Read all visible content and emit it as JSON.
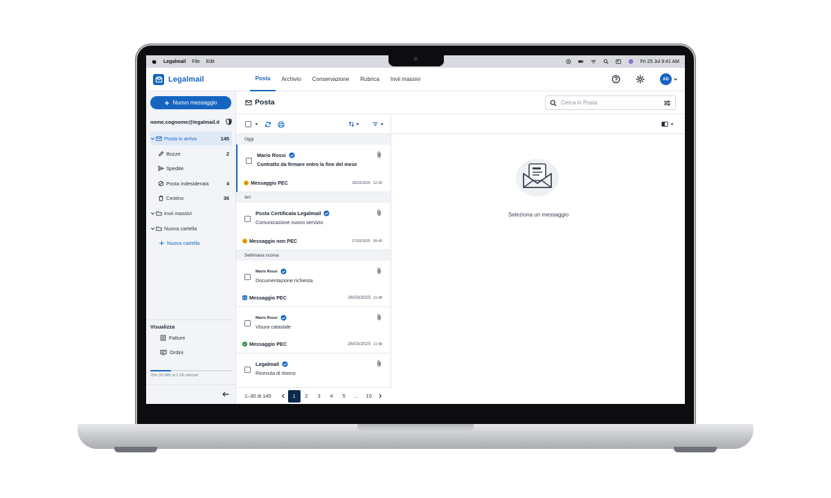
{
  "menubar": {
    "items": [
      "Legalmail",
      "File",
      "Edit"
    ],
    "datetime": "Fri 25 Jul  9:41 AM"
  },
  "brand": {
    "name": "Legalmail",
    "accent": "#1565c0"
  },
  "nav": {
    "tabs": [
      {
        "label": "Posta",
        "active": true
      },
      {
        "label": "Archivio"
      },
      {
        "label": "Conservazione"
      },
      {
        "label": "Rubrica"
      },
      {
        "label": "Invii massivi"
      }
    ],
    "avatar_initials": "AD"
  },
  "sidebar": {
    "new_message_label": "Nuovo messaggio",
    "account": "nome.cognome@legalmail.it",
    "folders": [
      {
        "label": "Posta in arrivo",
        "count": "145",
        "icon": "inbox-icon",
        "active": true
      },
      {
        "label": "Bozze",
        "count": "2",
        "icon": "pencil-icon"
      },
      {
        "label": "Spedite",
        "count": "",
        "icon": "send-icon"
      },
      {
        "label": "Posta indesiderata",
        "count": "4",
        "icon": "block-icon"
      },
      {
        "label": "Cestino",
        "count": "36",
        "icon": "trash-icon"
      }
    ],
    "groups": [
      {
        "label": "Invii massivi"
      },
      {
        "label": "Nuova cartella"
      }
    ],
    "add_folder_label": "Nuova cartella",
    "view_label": "Visualizza",
    "views": [
      {
        "label": "Fatture",
        "icon": "invoice-icon"
      },
      {
        "label": "Ordini",
        "icon": "orders-icon"
      }
    ],
    "storage_text": "25% (50 MB) di 2 GB utilizzati",
    "storage_fraction": 0.25
  },
  "main": {
    "title": "Posta",
    "search_placeholder": "Cerca in Posta"
  },
  "list": {
    "sections": [
      {
        "label": "Oggi",
        "messages": [
          {
            "sender": "Mario Rossi",
            "subject": "Contratto da firmare entro la fine del mese",
            "type": "Messaggio PEC",
            "type_color": "#e0a800",
            "date": "28/03/2025",
            "time": "12:36",
            "attachment": true,
            "selected": true,
            "unread": true
          }
        ]
      },
      {
        "label": "Ieri",
        "messages": [
          {
            "sender": "Posta Certificata Legalmail",
            "subject": "Comunicazione nuovo servizio",
            "type": "Messaggio non PEC",
            "type_color": "#e0a800",
            "date": "27/03/2025",
            "time": "09:45",
            "attachment": true
          }
        ]
      },
      {
        "label": "Settimana scorsa",
        "messages": [
          {
            "sender": "Mario Rossi",
            "subject": "Documentazione richiesta",
            "type": "Messaggio PEC",
            "type_color": "#1565c0",
            "date": "26/03/2025",
            "time": "11:48",
            "attachment": true
          },
          {
            "sender": "Mario Rossi",
            "subject": "Visura catastale",
            "type": "Messaggio PEC",
            "type_color": "#1e8e3e",
            "date": "26/03/2025",
            "time": "11:48",
            "attachment": true
          },
          {
            "sender": "Legalmail",
            "subject": "Ricevuta di ritorno",
            "type": "",
            "date": "",
            "time": "",
            "attachment": true
          }
        ]
      }
    ],
    "pagination": {
      "range": "1–30 di 145",
      "pages": [
        "1",
        "2",
        "3",
        "4",
        "5",
        "...",
        "10"
      ],
      "current": "1"
    }
  },
  "reading": {
    "empty_text": "Seleziona un messaggio"
  }
}
